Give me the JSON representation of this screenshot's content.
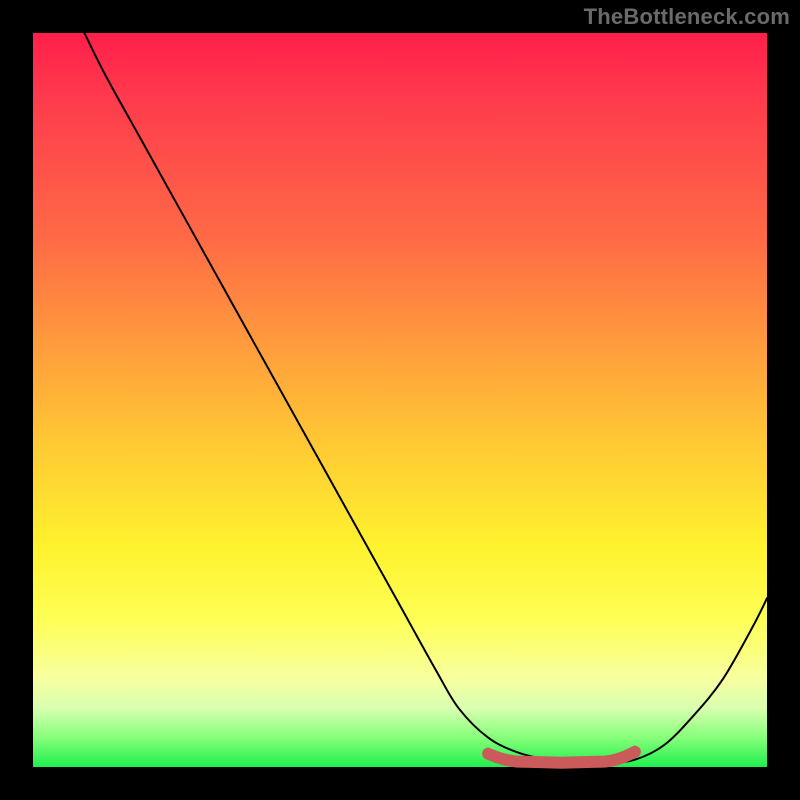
{
  "watermark": "TheBottleneck.com",
  "colors": {
    "background": "#000000",
    "gradient_stops": [
      {
        "pos": 0.0,
        "hex": "#ff1f4a"
      },
      {
        "pos": 0.09,
        "hex": "#ff3b4d"
      },
      {
        "pos": 0.28,
        "hex": "#ff6a46"
      },
      {
        "pos": 0.42,
        "hex": "#ff9a3d"
      },
      {
        "pos": 0.56,
        "hex": "#ffc934"
      },
      {
        "pos": 0.7,
        "hex": "#fff22e"
      },
      {
        "pos": 0.8,
        "hex": "#feff56"
      },
      {
        "pos": 0.88,
        "hex": "#f7ffa0"
      },
      {
        "pos": 0.92,
        "hex": "#d8ffb0"
      },
      {
        "pos": 0.96,
        "hex": "#86ff7a"
      },
      {
        "pos": 1.0,
        "hex": "#1fef4d"
      }
    ],
    "curve_stroke": "#000000",
    "marker_stroke": "#cb5b5b"
  },
  "chart_data": {
    "type": "line",
    "title": "",
    "xlabel": "",
    "ylabel": "",
    "xlim": [
      0,
      100
    ],
    "ylim": [
      0,
      100
    ],
    "grid": false,
    "legend": false,
    "series": [
      {
        "name": "bottleneck-curve",
        "x": [
          7,
          10,
          15,
          20,
          25,
          30,
          35,
          40,
          45,
          50,
          55,
          58,
          62,
          66,
          70,
          74,
          78,
          82,
          86,
          90,
          94,
          98,
          100
        ],
        "y": [
          100,
          94,
          85,
          76,
          67,
          58,
          49,
          40,
          31,
          22,
          13,
          8,
          4,
          2,
          1,
          0.5,
          0.5,
          1,
          3,
          7,
          12,
          19,
          23
        ]
      }
    ],
    "annotations": [
      {
        "name": "optimal-range-marker",
        "type": "segment",
        "x_start": 62,
        "x_end": 82,
        "y": 1.0,
        "note": "highlighted flat region near minimum"
      }
    ]
  }
}
